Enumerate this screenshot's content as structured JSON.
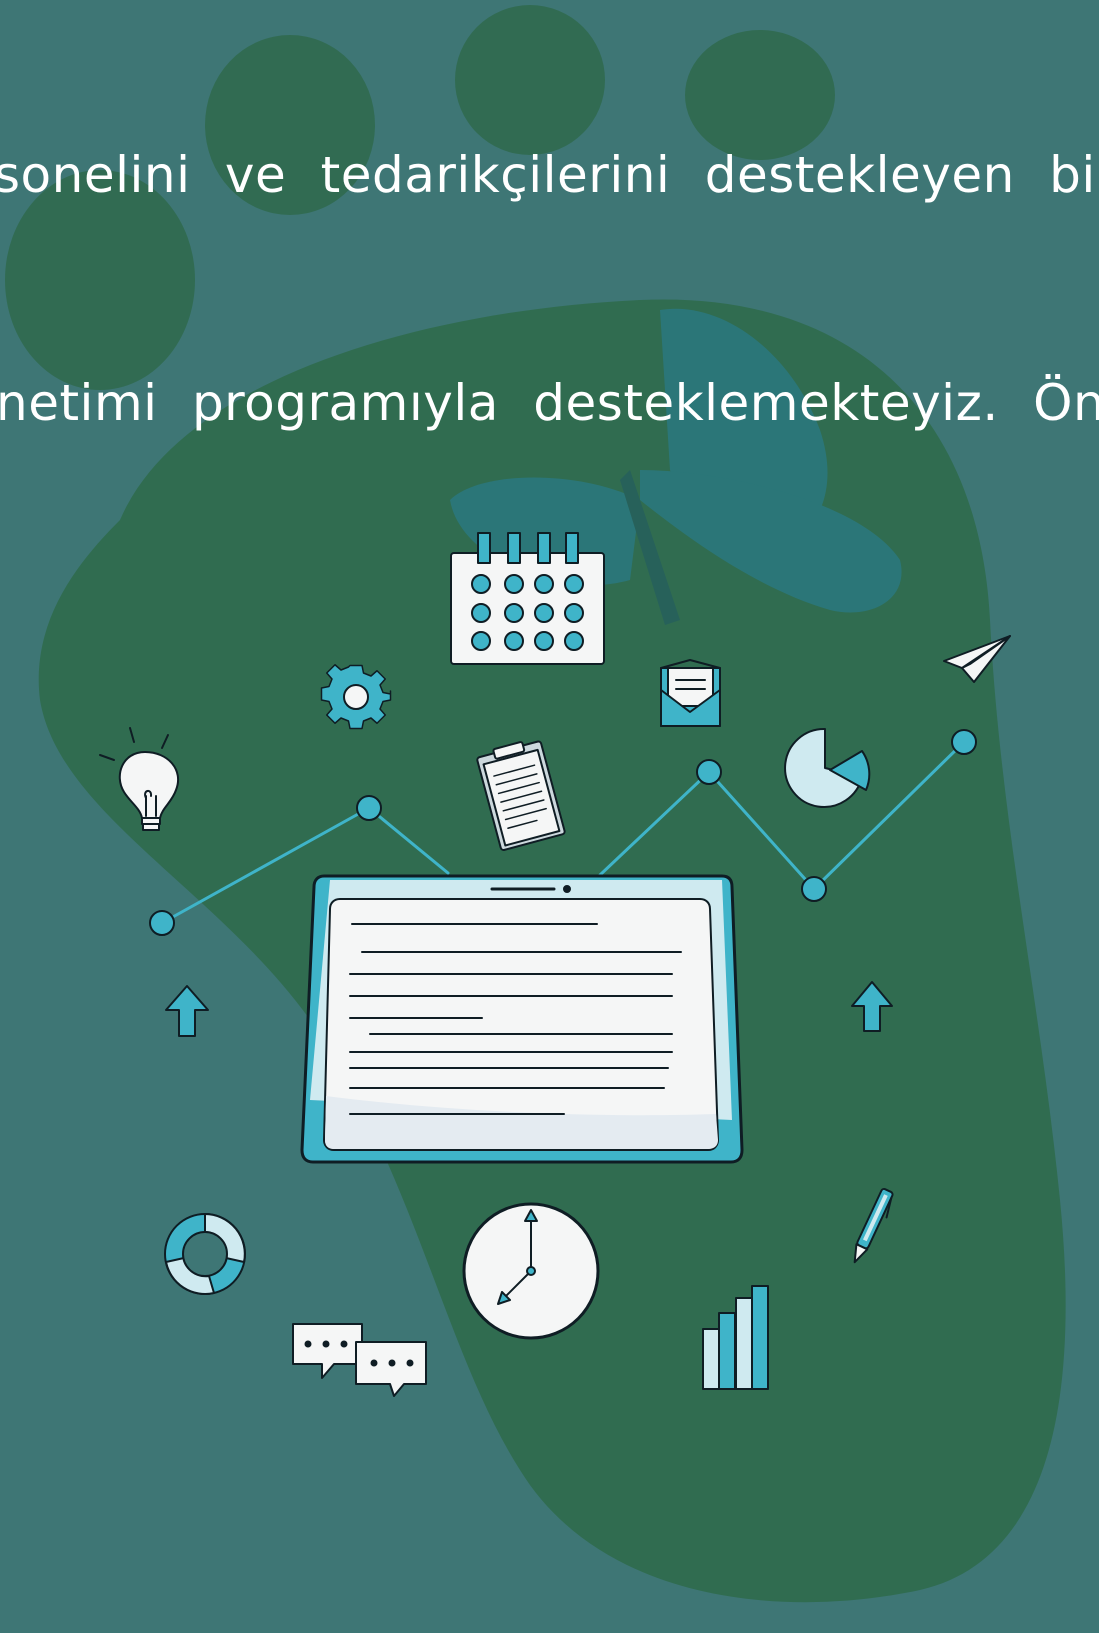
{
  "text_lines": [
    "sonelini ve tedarikçilerini destekleyen bir is",
    "netimi programıyla desteklemekteyiz. Önce"
  ],
  "colors": {
    "background": "#3e7675",
    "moss": "#2f6b4f",
    "accent": "#3fb4c9",
    "accent_light": "#cfeaf0",
    "paper": "#f5f6f6",
    "outline": "#0f1d24"
  },
  "illustration_icons": [
    "calendar-icon",
    "gear-icon",
    "lightbulb-icon",
    "clipboard-icon",
    "envelope-icon",
    "pie-chart-icon",
    "paper-plane-icon",
    "tablet-document",
    "arrow-up-icon",
    "donut-chart-icon",
    "clock-icon",
    "chat-bubbles-icon",
    "bar-chart-icon",
    "pen-icon",
    "trend-line"
  ]
}
